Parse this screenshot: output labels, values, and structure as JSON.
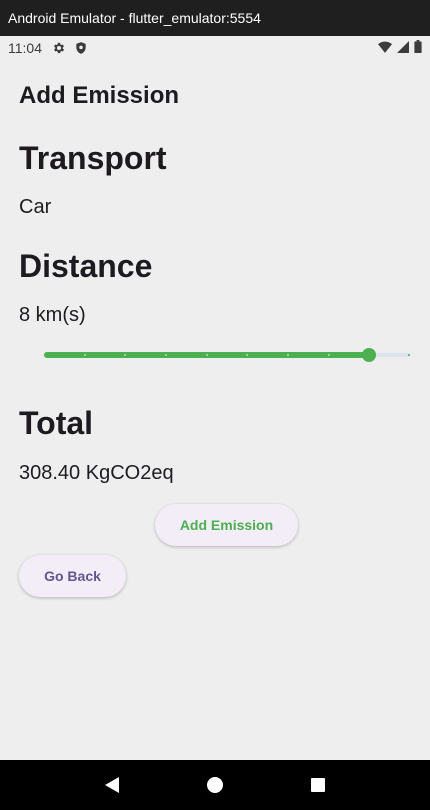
{
  "window": {
    "title": "Android Emulator - flutter_emulator:5554"
  },
  "status_bar": {
    "time": "11:04",
    "left_icons": [
      "settings-icon",
      "shield-icon"
    ],
    "right_icons": [
      "wifi-icon",
      "signal-icon",
      "battery-icon"
    ]
  },
  "app": {
    "title": "Add Emission",
    "transport": {
      "heading": "Transport",
      "value": "Car"
    },
    "distance": {
      "heading": "Distance",
      "value_text": "8 km(s)",
      "slider": {
        "value": 8,
        "min": 0,
        "max": 9,
        "divisions": 9,
        "active_color": "#4caf50",
        "inactive_color": "#dde3ea"
      }
    },
    "total": {
      "heading": "Total",
      "value": "308.40 KgCO2eq"
    },
    "add_button": {
      "label": "Add Emission",
      "color": "#4caf50"
    },
    "back_button": {
      "label": "Go Back",
      "color": "#65558f"
    }
  },
  "nav_bar": {
    "buttons": [
      "back-icon",
      "home-icon",
      "recents-icon"
    ]
  }
}
